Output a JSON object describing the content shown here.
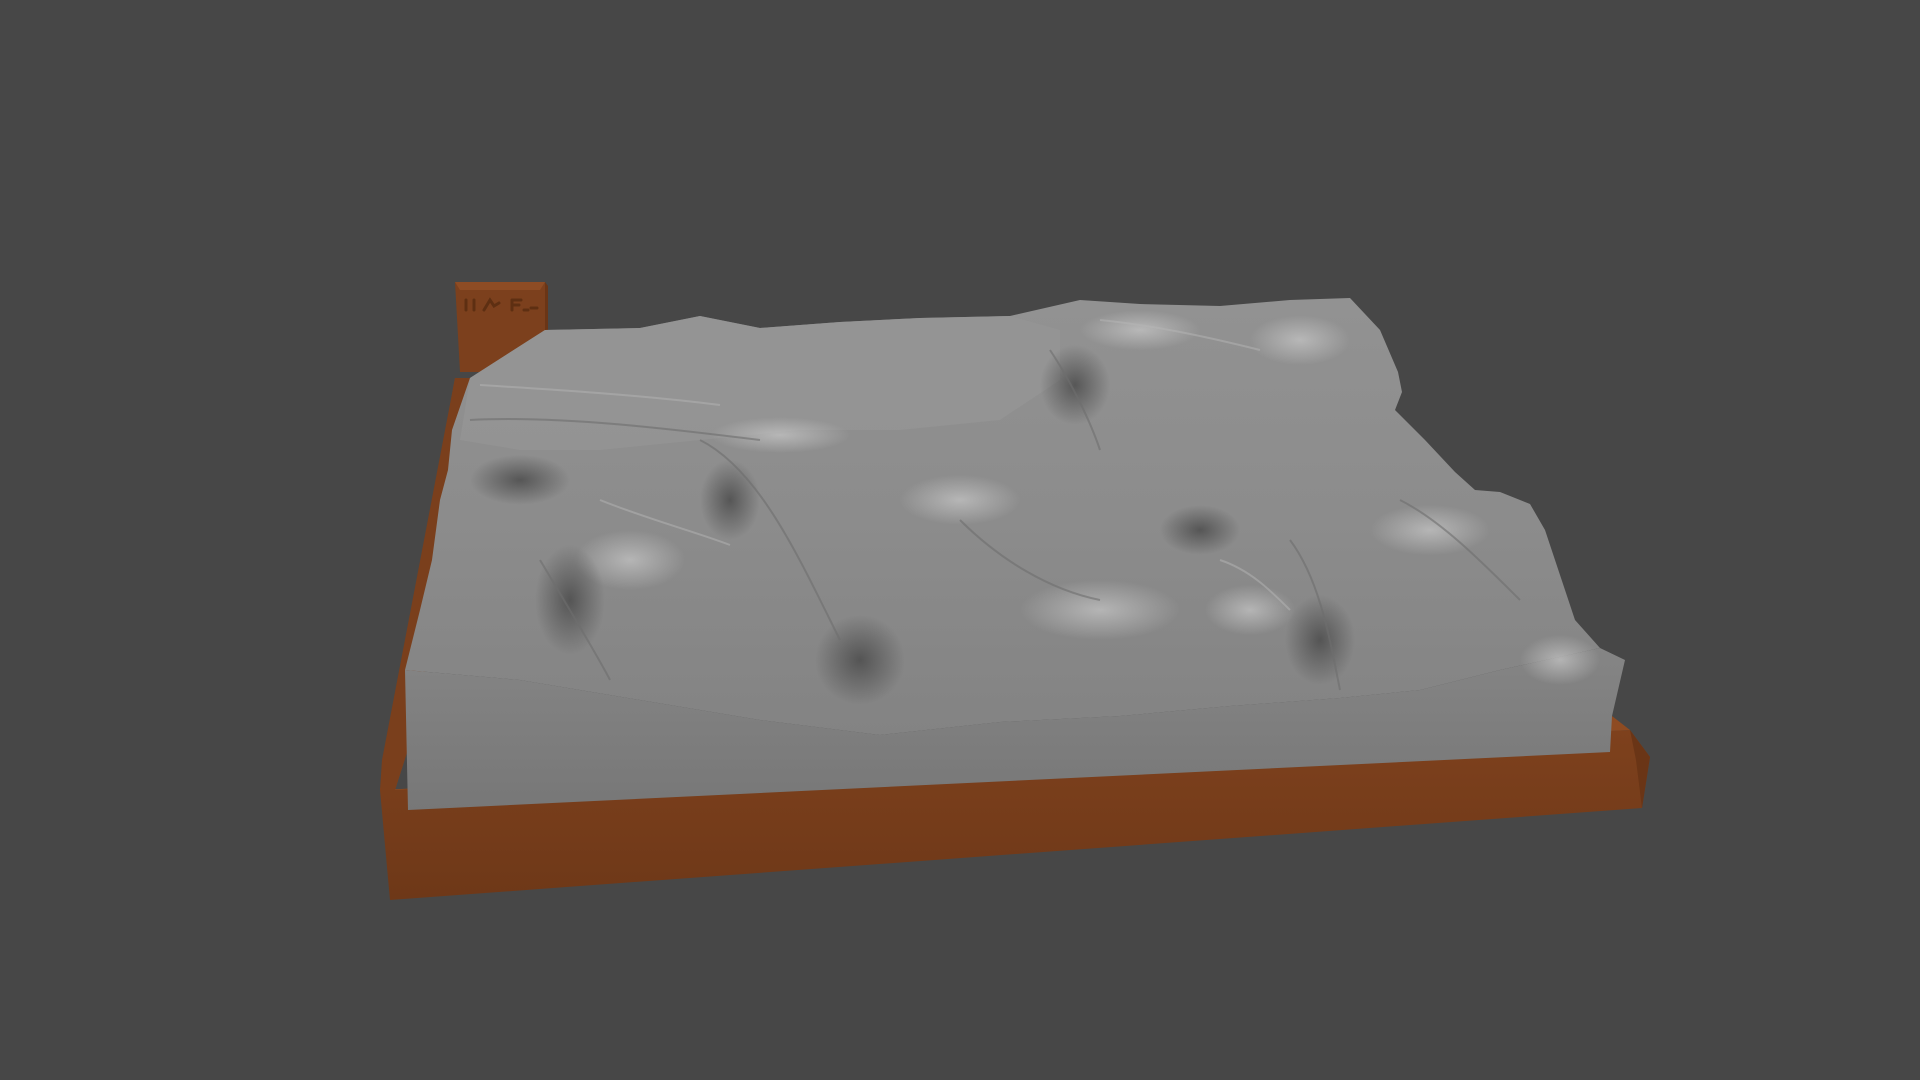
{
  "scene": {
    "subject": "terrain-relief-model",
    "colors": {
      "background": "#474747",
      "terrain": "#8a8a8a",
      "terrain_light": "#a3a3a3",
      "terrain_shadow": "#555555",
      "base": "#7a3f1c",
      "base_dark": "#6a3516",
      "base_light": "#8b4a22",
      "cliff_face": "#7d7d7d"
    }
  }
}
